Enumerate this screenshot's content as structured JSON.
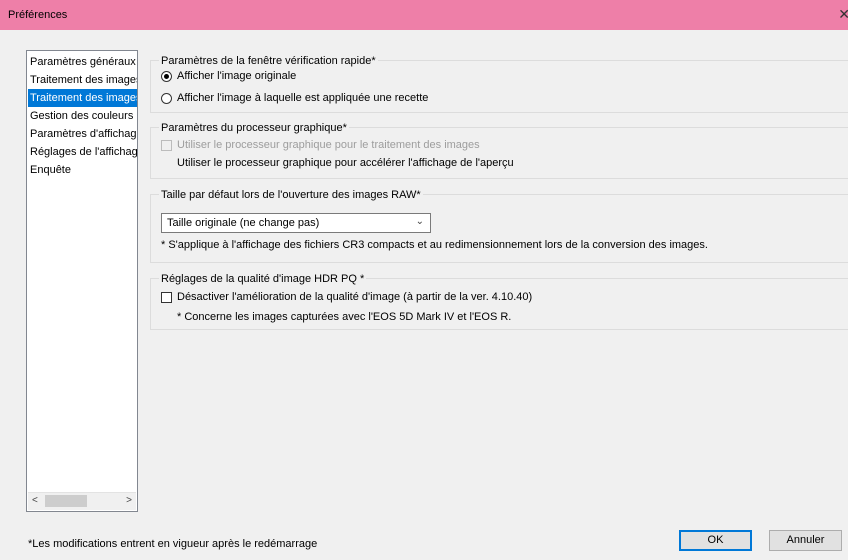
{
  "window": {
    "title": "Préférences",
    "close_glyph": "✕"
  },
  "sidebar": {
    "items": [
      {
        "label": "Paramètres généraux"
      },
      {
        "label": "Traitement des images"
      },
      {
        "label": "Traitement des images",
        "selected": true
      },
      {
        "label": "Gestion des couleurs"
      },
      {
        "label": "Paramètres d'affichage"
      },
      {
        "label": "Réglages de l'affichage"
      },
      {
        "label": "Enquête"
      }
    ],
    "scroll_left": "<",
    "scroll_right": ">"
  },
  "quick_check": {
    "legend": "Paramètres de la fenêtre vérification rapide*",
    "options": [
      {
        "label": "Afficher l'image originale",
        "selected": true
      },
      {
        "label": "Afficher l'image à laquelle est appliquée une recette",
        "selected": false
      }
    ]
  },
  "gpu": {
    "legend": "Paramètres du processeur graphique*",
    "checkbox_label": "Utiliser le processeur graphique pour le traitement des images",
    "checkbox_disabled": true,
    "preview_text": "Utiliser le processeur graphique pour accélérer l'affichage de l'aperçu"
  },
  "raw_size": {
    "legend": "Taille par défaut lors de l'ouverture des images RAW*",
    "selected": "Taille originale (ne change pas)",
    "note": "* S'applique à l'affichage des fichiers CR3 compacts et au redimensionnement lors de la conversion des images."
  },
  "hdr": {
    "legend": "Réglages de la qualité d'image HDR PQ *",
    "checkbox_label": "Désactiver l'amélioration de la qualité d'image (à partir de la ver. 4.10.40)",
    "note": "* Concerne les images capturées avec l'EOS 5D Mark IV et l'EOS R."
  },
  "footer": {
    "restart_note": "*Les modifications entrent en vigueur après le redémarrage",
    "ok_label": "OK",
    "cancel_label": "Annuler"
  },
  "colors": {
    "titlebar": "#ee7fa8",
    "selection": "#0078d7"
  }
}
